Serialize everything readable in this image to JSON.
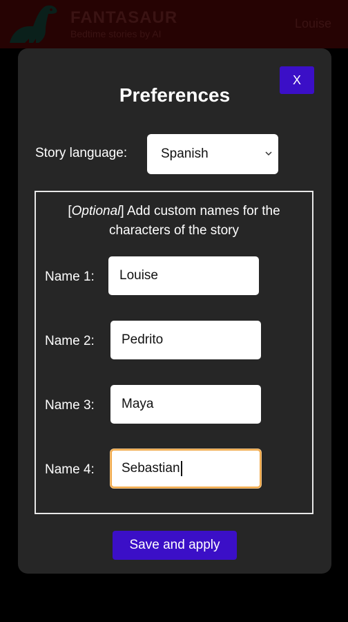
{
  "header": {
    "brand": "FANTASAUR",
    "subtitle": "Bedtime stories by AI",
    "user": "Louise"
  },
  "modal": {
    "close_label": "X",
    "title": "Preferences",
    "language_label": "Story language:",
    "language_value": "Spanish",
    "names_desc_optional": "Optional",
    "names_desc_line1": "] Add custom names for the",
    "names_desc_line2": "characters of the story",
    "names": [
      {
        "label": "Name 1:",
        "value": "Louise"
      },
      {
        "label": "Name 2:",
        "value": "Pedrito"
      },
      {
        "label": "Name 3:",
        "value": "Maya"
      },
      {
        "label": "Name 4:",
        "value": "Sebastian"
      }
    ],
    "save_label": "Save and apply"
  },
  "colors": {
    "accent": "#3b0fc7",
    "focus_border": "#f0a94a",
    "modal_bg": "#262626",
    "header_bg": "#3b0505"
  },
  "icons": {
    "logo": "dinosaur-icon",
    "select_chevron": "chevron-down-icon"
  }
}
